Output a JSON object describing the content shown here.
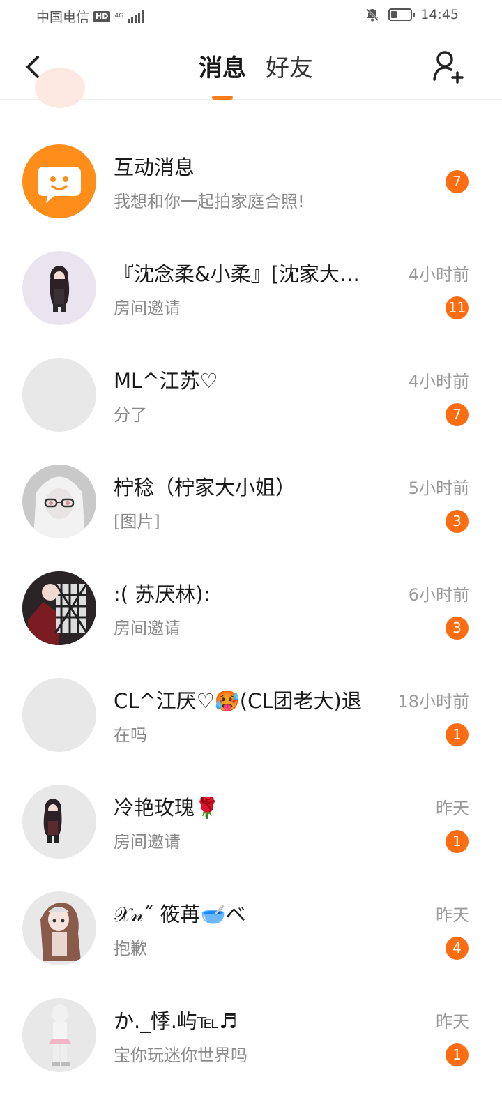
{
  "status_bar": {
    "carrier": "中国电信",
    "hd": "HD",
    "network": "4G",
    "time": "14:45",
    "battery_level": 0.3
  },
  "header": {
    "back_icon": "chevron-left-icon",
    "tabs": [
      {
        "label": "消息",
        "active": true
      },
      {
        "label": "好友",
        "active": false
      }
    ],
    "add_friend_icon": "add-user-icon"
  },
  "colors": {
    "accent": "#ff6d12",
    "interaction_avatar": "#ff8d1a"
  },
  "conversations": [
    {
      "name": "互动消息",
      "preview": "我想和你一起拍家庭合照!",
      "time": "",
      "unread": "7",
      "avatar": "chat-bubble-icon"
    },
    {
      "name": "『沈念柔&小柔』[沈家大小姐]",
      "preview": "房间邀请",
      "time": "4小时前",
      "unread": "11",
      "avatar": "avatar-image"
    },
    {
      "name": "ML^江苏♡",
      "preview": "分了",
      "time": "4小时前",
      "unread": "7",
      "avatar": "blank-avatar"
    },
    {
      "name": "柠稔（柠家大小姐）",
      "preview": "[图片]",
      "time": "5小时前",
      "unread": "3",
      "avatar": "avatar-image"
    },
    {
      "name": ":( 苏厌林):",
      "preview": "房间邀请",
      "time": "6小时前",
      "unread": "3",
      "avatar": "avatar-image"
    },
    {
      "name": "CL^江厌♡🥵(CL团老大)退",
      "preview": "在吗",
      "time": "18小时前",
      "unread": "1",
      "avatar": "blank-avatar"
    },
    {
      "name": "冷艳玫瑰🌹",
      "preview": "房间邀请",
      "time": "昨天",
      "unread": "1",
      "avatar": "avatar-image"
    },
    {
      "name": "𝒳𝓃˝ 筱苒🥣ベ",
      "preview": "抱歉",
      "time": "昨天",
      "unread": "4",
      "avatar": "avatar-image"
    },
    {
      "name": "か._悸.屿℡♬",
      "preview": "宝你玩迷你世界吗",
      "time": "昨天",
      "unread": "1",
      "avatar": "avatar-image"
    }
  ]
}
